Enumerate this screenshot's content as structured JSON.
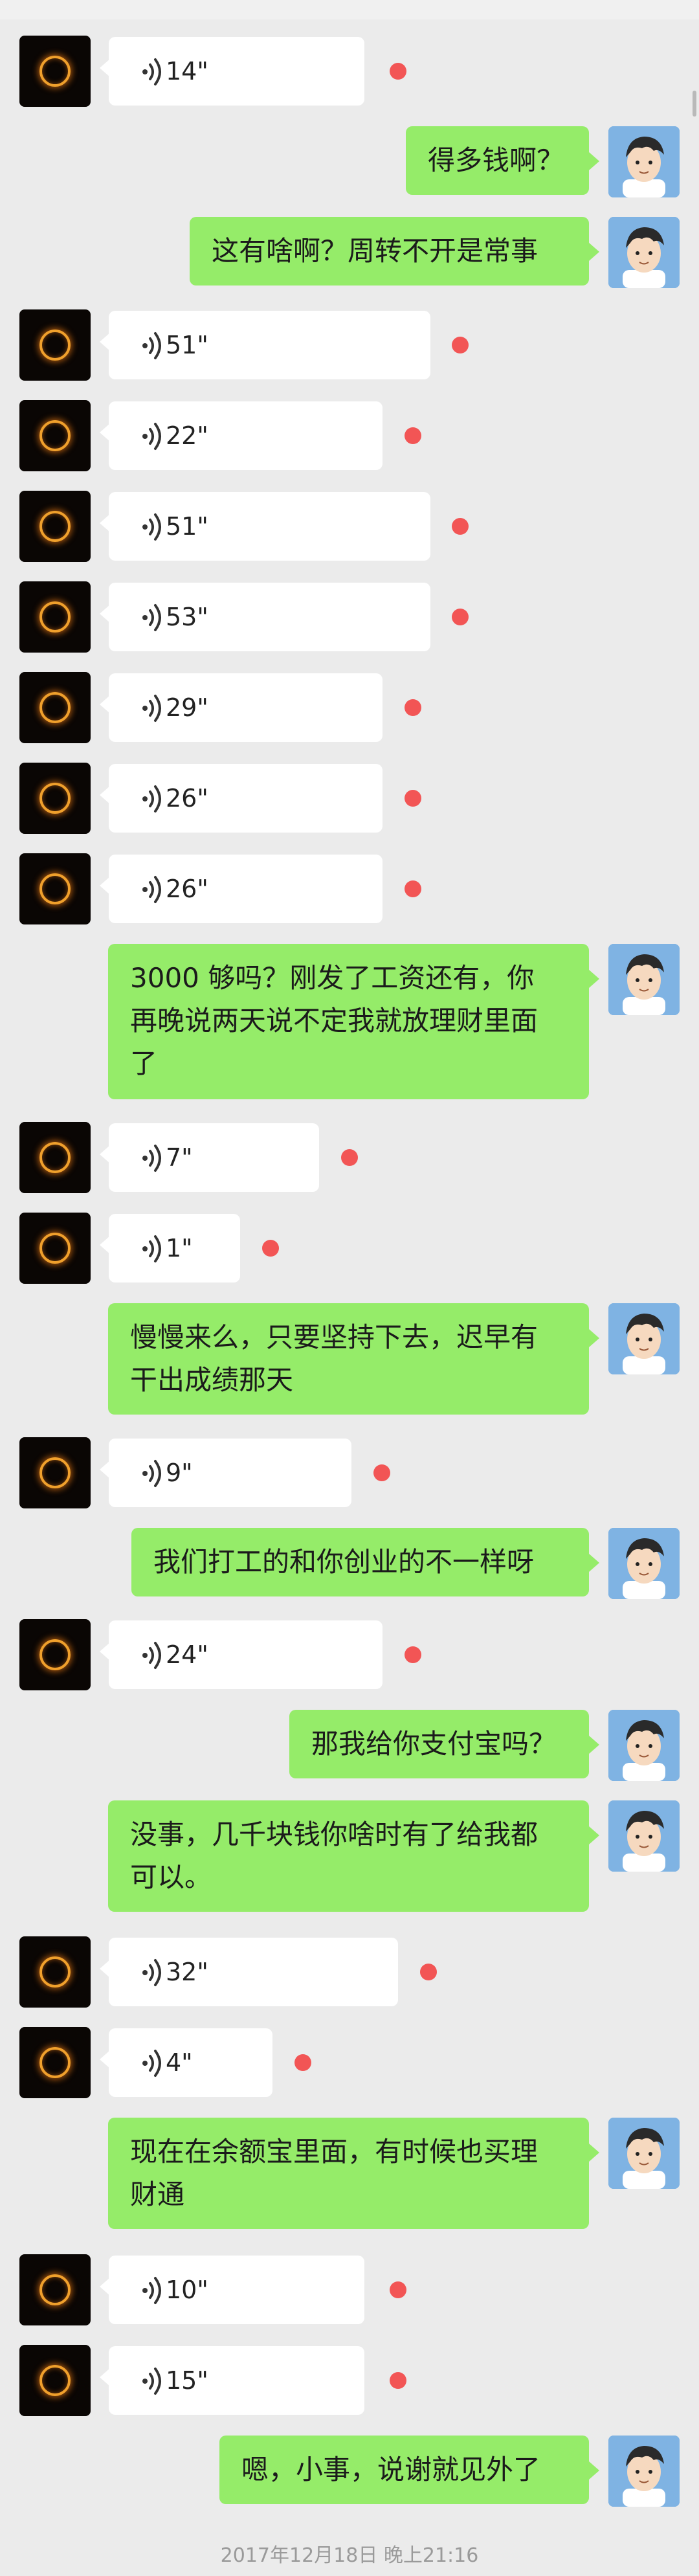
{
  "conversation": {
    "messages": [
      {
        "from": "other",
        "type": "voice",
        "duration": "14\""
      },
      {
        "from": "self",
        "type": "text",
        "text": "得多钱啊？"
      },
      {
        "from": "self",
        "type": "text",
        "text": "这有啥啊？周转不开是常事"
      },
      {
        "from": "other",
        "type": "voice",
        "duration": "51\""
      },
      {
        "from": "other",
        "type": "voice",
        "duration": "22\""
      },
      {
        "from": "other",
        "type": "voice",
        "duration": "51\""
      },
      {
        "from": "other",
        "type": "voice",
        "duration": "53\""
      },
      {
        "from": "other",
        "type": "voice",
        "duration": "29\""
      },
      {
        "from": "other",
        "type": "voice",
        "duration": "26\""
      },
      {
        "from": "other",
        "type": "voice",
        "duration": "26\""
      },
      {
        "from": "self",
        "type": "text",
        "lines": [
          "3000 够吗？刚发了工资还有，你",
          "再晚说两天说不定我就放理财里面",
          "了"
        ]
      },
      {
        "from": "other",
        "type": "voice",
        "duration": "7\""
      },
      {
        "from": "other",
        "type": "voice",
        "duration": "1\""
      },
      {
        "from": "self",
        "type": "text",
        "lines": [
          "慢慢来么，只要坚持下去，迟早有",
          "干出成绩那天"
        ]
      },
      {
        "from": "other",
        "type": "voice",
        "duration": "9\""
      },
      {
        "from": "self",
        "type": "text",
        "text": "我们打工的和你创业的不一样呀"
      },
      {
        "from": "other",
        "type": "voice",
        "duration": "24\""
      },
      {
        "from": "self",
        "type": "text",
        "text": "那我给你支付宝吗？"
      },
      {
        "from": "self",
        "type": "text",
        "lines": [
          "没事，几千块钱你啥时有了给我都",
          "可以。"
        ]
      },
      {
        "from": "other",
        "type": "voice",
        "duration": "32\""
      },
      {
        "from": "other",
        "type": "voice",
        "duration": "4\""
      },
      {
        "from": "self",
        "type": "text",
        "lines": [
          "现在在余额宝里面，有时候也买理",
          "财通"
        ]
      },
      {
        "from": "other",
        "type": "voice",
        "duration": "10\""
      },
      {
        "from": "other",
        "type": "voice",
        "duration": "15\""
      },
      {
        "from": "self",
        "type": "text",
        "text": "嗯，小事，说谢就见外了"
      }
    ],
    "timestamp": "2017年12月18日 晚上21:16"
  },
  "colors": {
    "background": "#ebebeb",
    "self_bubble": "#95ec69",
    "other_bubble": "#ffffff",
    "unread_dot": "#f25555"
  },
  "icons": {
    "voice": "voice-wave-icon",
    "other_avatar": "eclipse-ring-avatar",
    "self_avatar": "cartoon-boy-avatar"
  }
}
